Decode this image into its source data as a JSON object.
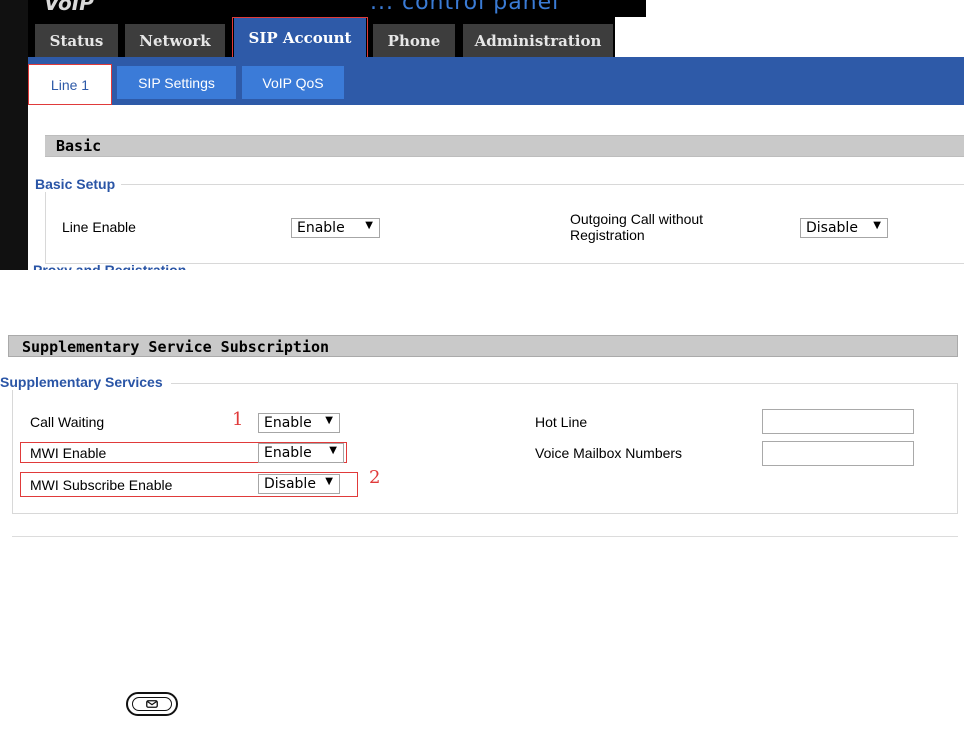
{
  "header": {
    "brand": "VoIP",
    "tagline": "... control panel"
  },
  "tabs": [
    "Status",
    "Network",
    "SIP Account",
    "Phone",
    "Administration"
  ],
  "subtabs": [
    "Line 1",
    "SIP Settings",
    "VoIP QoS"
  ],
  "basic": {
    "section_title": "Basic",
    "group_title": "Basic Setup",
    "line_enable_label": "Line Enable",
    "line_enable_value": "Enable",
    "outgoing_label_1": "Outgoing Call without",
    "outgoing_label_2": "Registration",
    "outgoing_value": "Disable",
    "next_group_cut": "Proxy and Registration"
  },
  "supplementary": {
    "section_title": "Supplementary Service Subscription",
    "group_title": "Supplementary Services",
    "call_waiting_label": "Call Waiting",
    "call_waiting_value": "Enable",
    "mwi_enable_label": "MWI Enable",
    "mwi_enable_value": "Enable",
    "mwi_subscribe_label": "MWI Subscribe Enable",
    "mwi_subscribe_value": "Disable",
    "hot_line_label": "Hot Line",
    "hot_line_value": "",
    "voice_mailbox_label": "Voice Mailbox Numbers",
    "voice_mailbox_value": ""
  },
  "annotations": {
    "one": "1",
    "two": "2"
  },
  "colors": {
    "accent": "#2e5aa8",
    "subtab": "#3b7bd8",
    "highlight": "#e03a3a"
  },
  "icons": {
    "dropdown": "dropdown-arrow-icon",
    "mail_key": "message-key-icon"
  }
}
